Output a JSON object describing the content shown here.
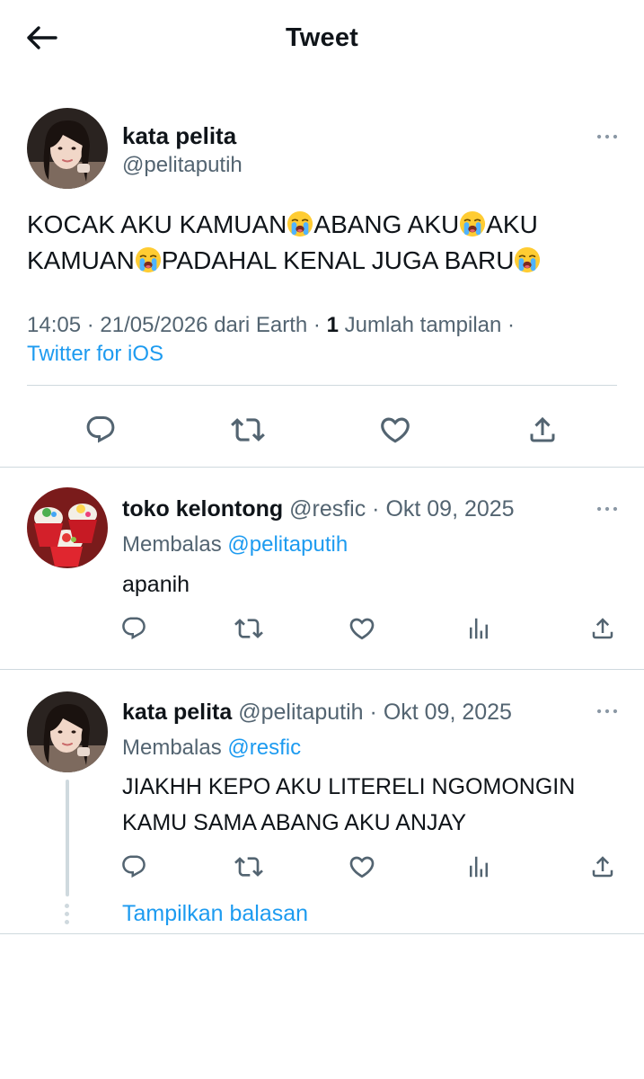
{
  "header": {
    "title": "Tweet",
    "back_icon": "arrow-left-icon"
  },
  "main_tweet": {
    "author_name": "kata pelita",
    "author_handle": "@pelitaputih",
    "text_segments": [
      "KOCAK AKU KAMUAN",
      "ABANG AKU",
      "AKU KAMUAN",
      "PADAHAL KENAL JUGA BARU"
    ],
    "emoji": "loudly-crying-face",
    "time": "14:05",
    "date": "21/05/2026",
    "location_text": "dari Earth",
    "views_count": "1",
    "views_label": "Jumlah tampilan",
    "source": "Twitter for iOS",
    "actions": [
      "reply-icon",
      "retweet-icon",
      "like-icon",
      "share-icon"
    ]
  },
  "replies": [
    {
      "author_name": "toko kelontong",
      "author_handle": "@resfic",
      "date": "Okt 09, 2025",
      "replying_label": "Membalas",
      "replying_to": "@pelitaputih",
      "text": "apanih",
      "avatar": "cupcakes-avatar"
    },
    {
      "author_name": "kata pelita",
      "author_handle": "@pelitaputih",
      "date": "Okt 09, 2025",
      "replying_label": "Membalas",
      "replying_to": "@resfic",
      "text": "JIAKHH KEPO AKU LITERELI NGOMONGIN KAMU SAMA ABANG AKU ANJAY",
      "avatar": "profile-photo-avatar"
    }
  ],
  "show_replies_label": "Tampilkan balasan",
  "colors": {
    "text": "#0f1419",
    "secondary": "#536471",
    "accent": "#1d9bf0",
    "border": "#cfd9de"
  }
}
